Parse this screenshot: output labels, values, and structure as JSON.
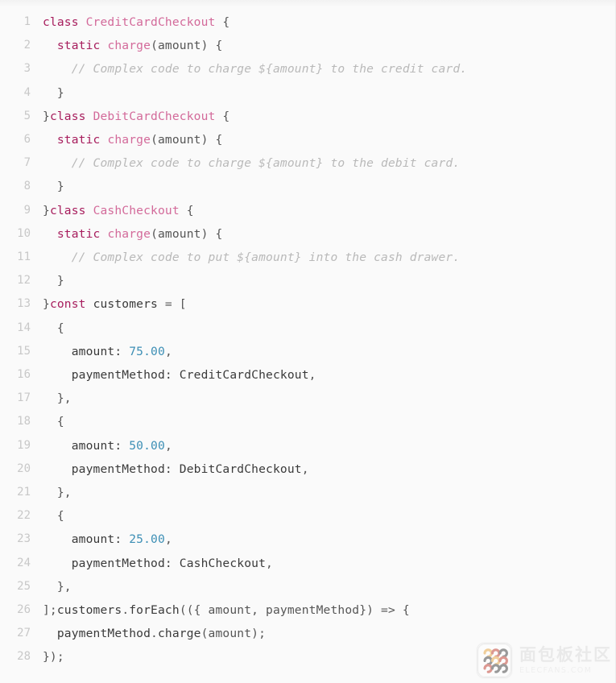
{
  "viewer": {
    "language": "javascript",
    "background_color": "#fafafa",
    "gutter_color": "#c8c8c8",
    "total_lines": 28
  },
  "theme": {
    "keyword_color": "#a71d5d",
    "class_color": "#d36a9a",
    "function_color": "#d36a9a",
    "number_color": "#3d8fb5",
    "comment_color": "#b9b9b9",
    "plain_color": "#3a3a3a"
  },
  "lines": [
    {
      "n": "1",
      "tokens": [
        {
          "t": "class",
          "c": "keyword"
        },
        {
          "t": " ",
          "c": "plain"
        },
        {
          "t": "CreditCardCheckout",
          "c": "class"
        },
        {
          "t": " {",
          "c": "punct"
        }
      ]
    },
    {
      "n": "2",
      "tokens": [
        {
          "t": "  ",
          "c": "plain"
        },
        {
          "t": "static",
          "c": "keyword"
        },
        {
          "t": " ",
          "c": "plain"
        },
        {
          "t": "charge",
          "c": "func"
        },
        {
          "t": "(amount) {",
          "c": "punct"
        }
      ]
    },
    {
      "n": "3",
      "tokens": [
        {
          "t": "    ",
          "c": "plain"
        },
        {
          "t": "// Complex code to charge ${amount} to the credit card.",
          "c": "comment"
        }
      ]
    },
    {
      "n": "4",
      "tokens": [
        {
          "t": "  }",
          "c": "punct"
        }
      ]
    },
    {
      "n": "5",
      "tokens": [
        {
          "t": "}",
          "c": "punct"
        },
        {
          "t": "class",
          "c": "keyword"
        },
        {
          "t": " ",
          "c": "plain"
        },
        {
          "t": "DebitCardCheckout",
          "c": "class"
        },
        {
          "t": " {",
          "c": "punct"
        }
      ]
    },
    {
      "n": "6",
      "tokens": [
        {
          "t": "  ",
          "c": "plain"
        },
        {
          "t": "static",
          "c": "keyword"
        },
        {
          "t": " ",
          "c": "plain"
        },
        {
          "t": "charge",
          "c": "func"
        },
        {
          "t": "(amount) {",
          "c": "punct"
        }
      ]
    },
    {
      "n": "7",
      "tokens": [
        {
          "t": "    ",
          "c": "plain"
        },
        {
          "t": "// Complex code to charge ${amount} to the debit card.",
          "c": "comment"
        }
      ]
    },
    {
      "n": "8",
      "tokens": [
        {
          "t": "  }",
          "c": "punct"
        }
      ]
    },
    {
      "n": "9",
      "tokens": [
        {
          "t": "}",
          "c": "punct"
        },
        {
          "t": "class",
          "c": "keyword"
        },
        {
          "t": " ",
          "c": "plain"
        },
        {
          "t": "CashCheckout",
          "c": "class"
        },
        {
          "t": " {",
          "c": "punct"
        }
      ]
    },
    {
      "n": "10",
      "tokens": [
        {
          "t": "  ",
          "c": "plain"
        },
        {
          "t": "static",
          "c": "keyword"
        },
        {
          "t": " ",
          "c": "plain"
        },
        {
          "t": "charge",
          "c": "func"
        },
        {
          "t": "(amount) {",
          "c": "punct"
        }
      ]
    },
    {
      "n": "11",
      "tokens": [
        {
          "t": "    ",
          "c": "plain"
        },
        {
          "t": "// Complex code to put ${amount} into the cash drawer.",
          "c": "comment"
        }
      ]
    },
    {
      "n": "12",
      "tokens": [
        {
          "t": "  }",
          "c": "punct"
        }
      ]
    },
    {
      "n": "13",
      "tokens": [
        {
          "t": "}",
          "c": "punct"
        },
        {
          "t": "const",
          "c": "keyword"
        },
        {
          "t": " ",
          "c": "plain"
        },
        {
          "t": "customers",
          "c": "plain"
        },
        {
          "t": " = [",
          "c": "punct"
        }
      ]
    },
    {
      "n": "14",
      "tokens": [
        {
          "t": "  {",
          "c": "punct"
        }
      ]
    },
    {
      "n": "15",
      "tokens": [
        {
          "t": "    ",
          "c": "plain"
        },
        {
          "t": "amount:",
          "c": "prop"
        },
        {
          "t": " ",
          "c": "plain"
        },
        {
          "t": "75.00",
          "c": "num"
        },
        {
          "t": ",",
          "c": "punct"
        }
      ]
    },
    {
      "n": "16",
      "tokens": [
        {
          "t": "    ",
          "c": "plain"
        },
        {
          "t": "paymentMethod:",
          "c": "prop"
        },
        {
          "t": " ",
          "c": "plain"
        },
        {
          "t": "CreditCardCheckout",
          "c": "plain"
        },
        {
          "t": ",",
          "c": "punct"
        }
      ]
    },
    {
      "n": "17",
      "tokens": [
        {
          "t": "  },",
          "c": "punct"
        }
      ]
    },
    {
      "n": "18",
      "tokens": [
        {
          "t": "  {",
          "c": "punct"
        }
      ]
    },
    {
      "n": "19",
      "tokens": [
        {
          "t": "    ",
          "c": "plain"
        },
        {
          "t": "amount:",
          "c": "prop"
        },
        {
          "t": " ",
          "c": "plain"
        },
        {
          "t": "50.00",
          "c": "num"
        },
        {
          "t": ",",
          "c": "punct"
        }
      ]
    },
    {
      "n": "20",
      "tokens": [
        {
          "t": "    ",
          "c": "plain"
        },
        {
          "t": "paymentMethod:",
          "c": "prop"
        },
        {
          "t": " ",
          "c": "plain"
        },
        {
          "t": "DebitCardCheckout",
          "c": "plain"
        },
        {
          "t": ",",
          "c": "punct"
        }
      ]
    },
    {
      "n": "21",
      "tokens": [
        {
          "t": "  },",
          "c": "punct"
        }
      ]
    },
    {
      "n": "22",
      "tokens": [
        {
          "t": "  {",
          "c": "punct"
        }
      ]
    },
    {
      "n": "23",
      "tokens": [
        {
          "t": "    ",
          "c": "plain"
        },
        {
          "t": "amount:",
          "c": "prop"
        },
        {
          "t": " ",
          "c": "plain"
        },
        {
          "t": "25.00",
          "c": "num"
        },
        {
          "t": ",",
          "c": "punct"
        }
      ]
    },
    {
      "n": "24",
      "tokens": [
        {
          "t": "    ",
          "c": "plain"
        },
        {
          "t": "paymentMethod:",
          "c": "prop"
        },
        {
          "t": " ",
          "c": "plain"
        },
        {
          "t": "CashCheckout",
          "c": "plain"
        },
        {
          "t": ",",
          "c": "punct"
        }
      ]
    },
    {
      "n": "25",
      "tokens": [
        {
          "t": "  },",
          "c": "punct"
        }
      ]
    },
    {
      "n": "26",
      "tokens": [
        {
          "t": "];",
          "c": "punct"
        },
        {
          "t": "customers",
          "c": "plain"
        },
        {
          "t": ".",
          "c": "punct"
        },
        {
          "t": "forEach",
          "c": "plain"
        },
        {
          "t": "(({ amount, paymentMethod}) => {",
          "c": "punct"
        }
      ]
    },
    {
      "n": "27",
      "tokens": [
        {
          "t": "  ",
          "c": "plain"
        },
        {
          "t": "paymentMethod",
          "c": "plain"
        },
        {
          "t": ".",
          "c": "punct"
        },
        {
          "t": "charge",
          "c": "plain"
        },
        {
          "t": "(amount);",
          "c": "punct"
        }
      ]
    },
    {
      "n": "28",
      "tokens": [
        {
          "t": "});",
          "c": "punct"
        }
      ]
    }
  ],
  "watermark": {
    "logo_icon": "breadboard-logo-icon",
    "title_cn": "面包板社区",
    "subtitle_en": "ELECFANS.COM",
    "logo_colors": [
      "#e8a33d",
      "#c0392b",
      "#3a3a3a",
      "#8a6d3b"
    ]
  }
}
